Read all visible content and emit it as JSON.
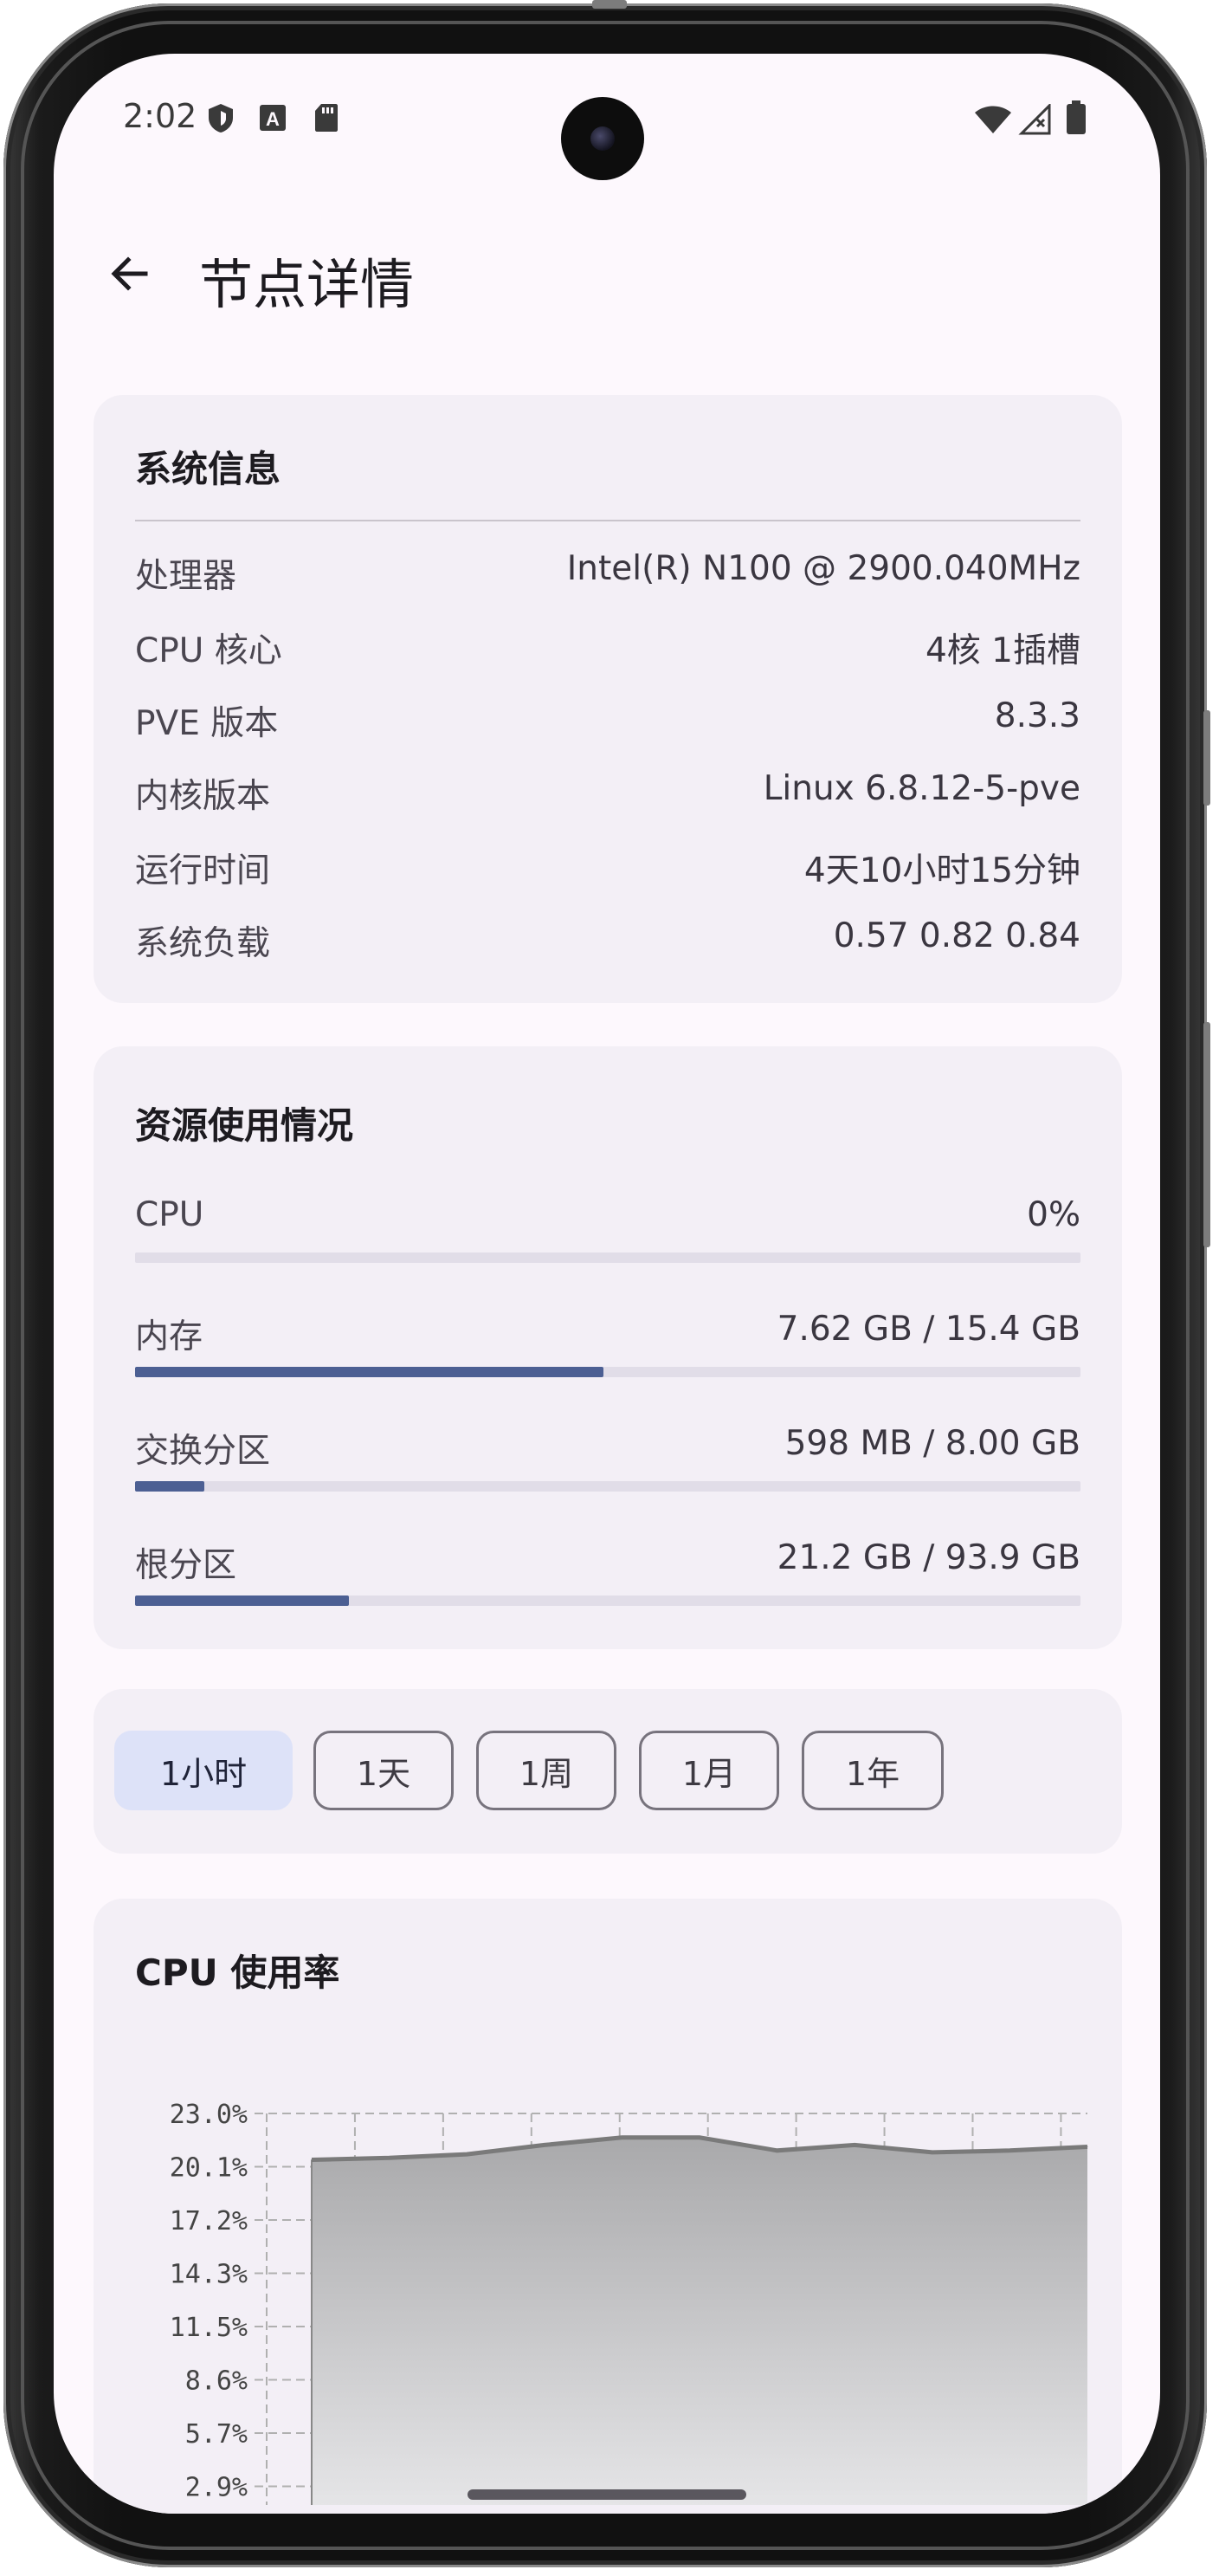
{
  "status_bar": {
    "time": "2:02",
    "left_icons": [
      "shield-icon",
      "text-a-icon",
      "sd-card-icon"
    ],
    "right_icons": [
      "wifi-icon",
      "signal-icon",
      "battery-icon"
    ]
  },
  "header": {
    "back_icon": "arrow-left-icon",
    "title": "节点详情"
  },
  "system_info": {
    "title": "系统信息",
    "rows": [
      {
        "label": "处理器",
        "value": "Intel(R) N100 @ 2900.040MHz"
      },
      {
        "label": "CPU 核心",
        "value": "4核 1插槽"
      },
      {
        "label": "PVE 版本",
        "value": "8.3.3"
      },
      {
        "label": "内核版本",
        "value": "Linux 6.8.12-5-pve"
      },
      {
        "label": "运行时间",
        "value": "4天10小时15分钟"
      },
      {
        "label": "系统负载",
        "value": "0.57 0.82 0.84"
      }
    ]
  },
  "resources": {
    "title": "资源使用情况",
    "items": [
      {
        "label": "CPU",
        "value": "0%",
        "fraction": 0.0
      },
      {
        "label": "内存",
        "value": "7.62 GB / 15.4 GB",
        "fraction": 0.495
      },
      {
        "label": "交换分区",
        "value": "598 MB / 8.00 GB",
        "fraction": 0.073
      },
      {
        "label": "根分区",
        "value": "21.2 GB / 93.9 GB",
        "fraction": 0.226
      }
    ]
  },
  "time_range": {
    "options": [
      "1小时",
      "1天",
      "1周",
      "1月",
      "1年"
    ],
    "selected": "1小时"
  },
  "cpu_chart_card": {
    "title": "CPU 使用率"
  },
  "colors": {
    "accent": "#4c5f93",
    "chip_selected": "#dde2f8",
    "card_bg": "#f3eff6",
    "page_bg": "#fdf8fd",
    "chart_line": "#7a7a7a"
  },
  "chart_data": {
    "type": "area",
    "title": "",
    "xlabel": "",
    "ylabel": "",
    "y_ticks": [
      "23.0%",
      "20.1%",
      "17.2%",
      "14.3%",
      "11.5%",
      "8.6%",
      "5.7%",
      "2.9%"
    ],
    "ylim": [
      0,
      23.0
    ],
    "grid": true,
    "series": [
      {
        "values": [
          20.5,
          20.6,
          20.8,
          21.3,
          21.7,
          21.7,
          21.0,
          21.3,
          20.9,
          21.0,
          21.2
        ]
      }
    ]
  }
}
